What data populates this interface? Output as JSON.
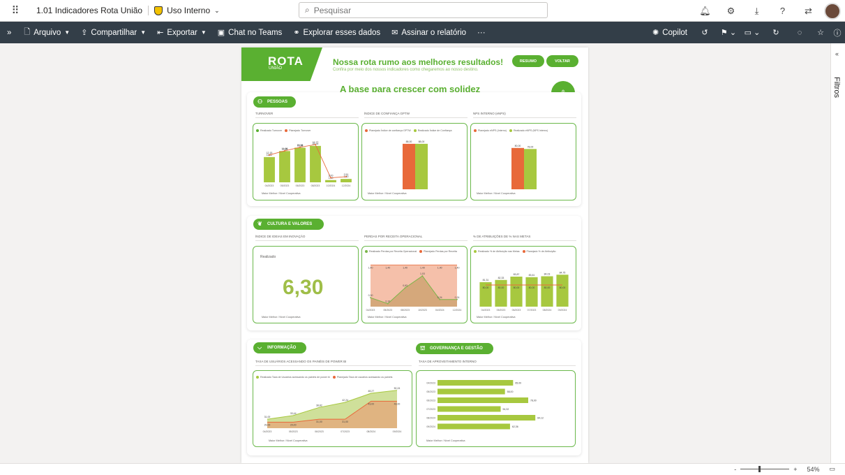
{
  "app": {
    "report_title": "1.01 Indicadores Rota União",
    "sensitivity": "Uso Interno",
    "search_placeholder": "Pesquisar"
  },
  "commands": {
    "arquivo": "Arquivo",
    "compartilhar": "Compartilhar",
    "exportar": "Exportar",
    "chat": "Chat no Teams",
    "explorar": "Explorar esses dados",
    "assinar": "Assinar o relatório",
    "more": "···",
    "copilot": "Copilot"
  },
  "filters_label": "Filtros",
  "status": {
    "zoom": "54%",
    "minus": "-",
    "plus": "+"
  },
  "report": {
    "logo": "ROTA",
    "logo_sub": "UNIÃO",
    "headline": "Nossa rota rumo aos melhores resultados!",
    "subheadline": "Confira por meio dos nossos indicadores como chegaremos ao nosso destino.",
    "btn_resumo": "RESUMO",
    "btn_voltar": "VOLTAR",
    "tagline": "A base para crescer com solidez",
    "sections": {
      "pessoas": "PESSOAS",
      "cultura": "CULTURA E VALORES",
      "informacao": "INFORMAÇÃO",
      "governanca": "GOVERNANÇA E GESTÃO"
    },
    "cards": {
      "turnover": "TURNOVER",
      "confianca": "ÍNDICE DE CONFIANÇA GPTW",
      "enps": "NPS INTERNO (eNPS)",
      "inovacao": "ÍNDICE DE IDEIAS EM INOVAÇÃO",
      "receita": "PERDAS POR RECEITA OPERACIONAL",
      "remuneracao": "% DE ATRIBUIÇÕES DE % NAS METAS",
      "usuarios": "TAXA DE USUÁRIOS ACESSANDO OS PAINÉIS DE POWER BI",
      "aproveitamento": "TAXA DE APROVEITAMENTO INTERNO"
    },
    "footer_text": "Maior Melhor / Nível Cooperativa",
    "realizado_label": "Realizado",
    "big_value": "6,30"
  },
  "chart_data": [
    {
      "type": "bar",
      "title": "TURNOVER",
      "categories": [
        "04/2023",
        "05/2023",
        "06/2023",
        "08/2023",
        "10/2024",
        "12/2024"
      ],
      "series": [
        {
          "name": "Realizado Turnover",
          "values": [
            11.22,
            13.88,
            15.38,
            16.18,
            1.0,
            1.5
          ],
          "color": "#a7c83f"
        },
        {
          "name": "Planejado Turnover",
          "values": [
            12.15,
            14.0,
            15.58,
            16.77,
            2.0,
            2.51
          ],
          "color": "#e8693a"
        }
      ]
    },
    {
      "type": "bar",
      "title": "ÍNDICE DE CONFIANÇA GPTW",
      "categories": [
        ""
      ],
      "series": [
        {
          "name": "Planejado Índice de confiança GPTW",
          "values": [
            88.0
          ],
          "color": "#e8693a"
        },
        {
          "name": "Realizado Índice de Confiança",
          "values": [
            88.0
          ],
          "color": "#a7c83f"
        }
      ]
    },
    {
      "type": "bar",
      "title": "NPS INTERNO (eNPS)",
      "categories": [
        ""
      ],
      "series": [
        {
          "name": "Planejado eNPS (Interno)",
          "values": [
            80.0
          ],
          "color": "#e8693a"
        },
        {
          "name": "Realizado eNPS (NPS Interno)",
          "values": [
            78.0
          ],
          "color": "#a7c83f"
        }
      ]
    },
    {
      "type": "area",
      "title": "PERDAS POR RECEITA OPERACIONAL",
      "categories": [
        "04/2023",
        "05/2023",
        "08/2023",
        "10/2023",
        "04/2024",
        "12/2024"
      ],
      "series": [
        {
          "name": "Realizado Perdas por Receita Operacional",
          "values": [
            0.3,
            0.1,
            0.63,
            1.03,
            0.24,
            0.24
          ],
          "color": "#7ab648"
        },
        {
          "name": "Planejado Perdas por Receita",
          "values": [
            1.4,
            1.4,
            1.4,
            1.4,
            1.4,
            1.4
          ],
          "color": "#e8693a"
        }
      ]
    },
    {
      "type": "bar",
      "title": "% DE ATRIBUIÇÕES DE % NAS METAS",
      "categories": [
        "04/2023",
        "05/2023",
        "06/2023",
        "07/2023",
        "08/2024",
        "09/2024"
      ],
      "series": [
        {
          "name": "Realizado % de Atribuição nas Metas",
          "values": [
            81.31,
            82.33,
            83.87,
            83.61,
            84.03,
            84.75
          ],
          "color": "#a7c83f"
        },
        {
          "name": "Planejado % de Atribuição",
          "values": [
            80.0,
            80.0,
            80.0,
            80.0,
            80.0,
            80.0
          ],
          "color": "#e8693a"
        }
      ]
    },
    {
      "type": "area",
      "title": "TAXA DE USUÁRIOS ACESSANDO OS PAINÉIS DE POWER BI",
      "categories": [
        "04/2023",
        "05/2023",
        "06/2023",
        "07/2023",
        "08/2024",
        "09/2024"
      ],
      "series": [
        {
          "name": "Realizado Taxa de Usuários acessando os painéis de power bi",
          "values": [
            31.0,
            33.44,
            38.82,
            42.24,
            48.27,
            50.24
          ],
          "color": "#a7c83f"
        },
        {
          "name": "Planejado Taxa de usuários acessando os painéis",
          "values": [
            29.0,
            29.0,
            31.0,
            31.0,
            43.0,
            43.0
          ],
          "color": "#e8693a"
        }
      ]
    },
    {
      "type": "bar",
      "title": "TAXA DE APROVEITAMENTO INTERNO",
      "categories": [
        "04/2023",
        "05/2023",
        "06/2023",
        "07/2023",
        "08/2024",
        "09/2024"
      ],
      "series": [
        {
          "name": "Realizado",
          "values": [
            65.0,
            58.0,
            78.0,
            54.32,
            84.12,
            62.36
          ],
          "color": "#a7c83f"
        }
      ]
    }
  ]
}
